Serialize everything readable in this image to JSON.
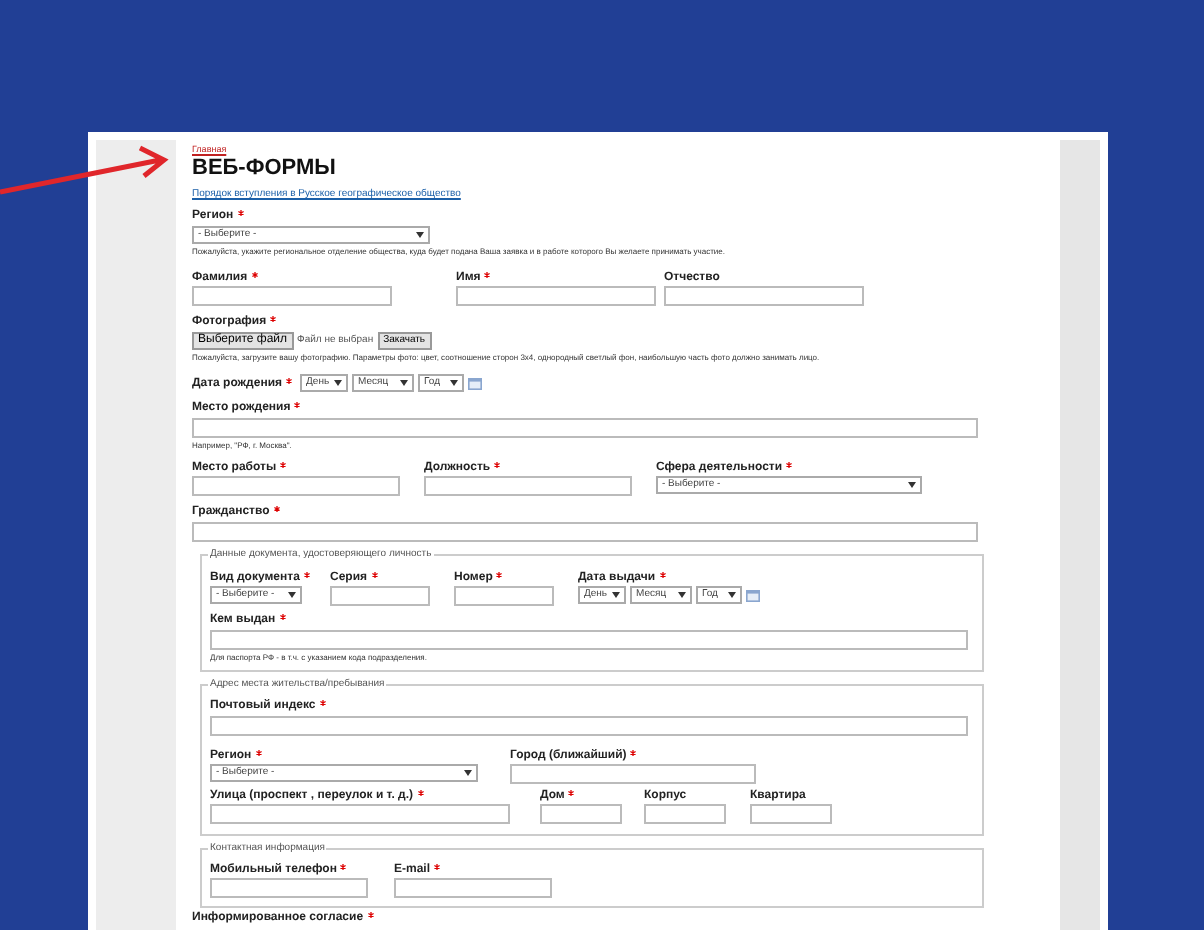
{
  "breadcrumb": "Главная",
  "title": "ВЕБ-ФОРМЫ",
  "intro_link": "Порядок вступления в Русское географическое общество",
  "region": {
    "label": "Регион",
    "required": true,
    "value": "- Выберите -",
    "hint": "Пожалуйста, укажите региональное отделение общества, куда будет подана Ваша заявка и в работе которого Вы желаете принимать участие."
  },
  "name_fields": [
    {
      "label": "Фамилия",
      "required": true
    },
    {
      "label": "Имя",
      "required": true
    },
    {
      "label": "Отчество",
      "required": false
    }
  ],
  "photo": {
    "label": "Фотография",
    "required": true,
    "choose_button": "Выберите файл",
    "file_status": "Файл не выбран",
    "upload_button": "Закачать",
    "hint": "Пожалуйста, загрузите вашу фотографию. Параметры фото: цвет, соотношение сторон 3x4, однородный светлый фон, наибольшую часть фото должно занимать лицо."
  },
  "birth_date": {
    "label": "Дата рождения",
    "required": true,
    "day": "День",
    "month": "Месяц",
    "year": "Год"
  },
  "birth_place": {
    "label": "Место рождения",
    "required": true,
    "hint": "Например, \"РФ, г. Москва\"."
  },
  "work_fields": [
    {
      "label": "Место работы",
      "required": true,
      "kind": "text"
    },
    {
      "label": "Должность",
      "required": true,
      "kind": "text"
    },
    {
      "label": "Сфера деятельности",
      "required": true,
      "kind": "select",
      "value": "- Выберите -"
    }
  ],
  "citizenship": {
    "label": "Гражданство",
    "required": true
  },
  "document": {
    "legend": "Данные документа, удостоверяющего личность",
    "fields": [
      {
        "label": "Вид документа",
        "required": true,
        "kind": "select",
        "value": "- Выберите -"
      },
      {
        "label": "Серия",
        "required": true,
        "kind": "text"
      },
      {
        "label": "Номер",
        "required": true,
        "kind": "text"
      },
      {
        "label": "Дата выдачи",
        "required": true,
        "kind": "date",
        "day": "День",
        "month": "Месяц",
        "year": "Год"
      }
    ],
    "issued_by": {
      "label": "Кем выдан",
      "required": true,
      "hint": "Для паспорта РФ - в т.ч. с указанием кода подразделения."
    }
  },
  "address": {
    "legend": "Адрес места жительства/пребывания",
    "postal": {
      "label": "Почтовый индекс",
      "required": true
    },
    "row_1": [
      {
        "label": "Регион",
        "required": true,
        "kind": "select",
        "value": "- Выберите -"
      },
      {
        "label": "Город (ближайший)",
        "required": true,
        "kind": "text"
      }
    ],
    "row_2": [
      {
        "label": "Улица (проспект , переулок и т. д.)",
        "required": true,
        "kind": "text"
      },
      {
        "label": "Дом",
        "required": true,
        "kind": "text"
      },
      {
        "label": "Корпус",
        "required": false,
        "kind": "text"
      },
      {
        "label": "Квартира",
        "required": false,
        "kind": "text"
      }
    ]
  },
  "contacts": {
    "legend": "Контактная информация",
    "fields": [
      {
        "label": "Мобильный телефон",
        "required": true,
        "kind": "text"
      },
      {
        "label": "E-mail",
        "required": true,
        "kind": "text"
      }
    ]
  },
  "consent": {
    "label": "Информированное согласие",
    "required": true
  }
}
